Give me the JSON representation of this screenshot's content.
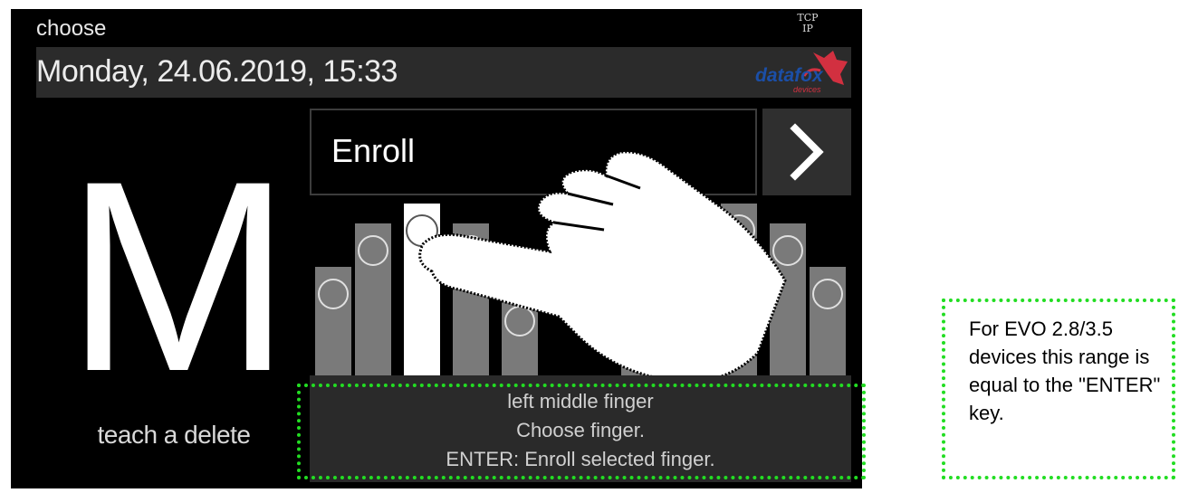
{
  "header": {
    "title": "choose",
    "network_badge_line1": "TCP",
    "network_badge_line2": "IP"
  },
  "datebar": {
    "datetime": "Monday, 24.06.2019, 15:33"
  },
  "logo": {
    "text": "datafox",
    "subtext": "devices",
    "brand_blue": "#1b4fa8",
    "brand_red": "#d23040"
  },
  "mode": {
    "letter": "M",
    "label": "teach a delete"
  },
  "action": {
    "label": "Enroll",
    "next_icon": "chevron-right-icon"
  },
  "fingers": {
    "selected": "left middle finger",
    "icon": "pointing-hand-icon"
  },
  "info": {
    "line1": "left middle finger",
    "line2": "Choose finger.",
    "line3": "ENTER: Enroll selected finger."
  },
  "annotation": {
    "text": "For EVO 2.8/3.5 devices this range is equal to the \"ENTER\" key.",
    "highlight_color": "#22dd22"
  }
}
